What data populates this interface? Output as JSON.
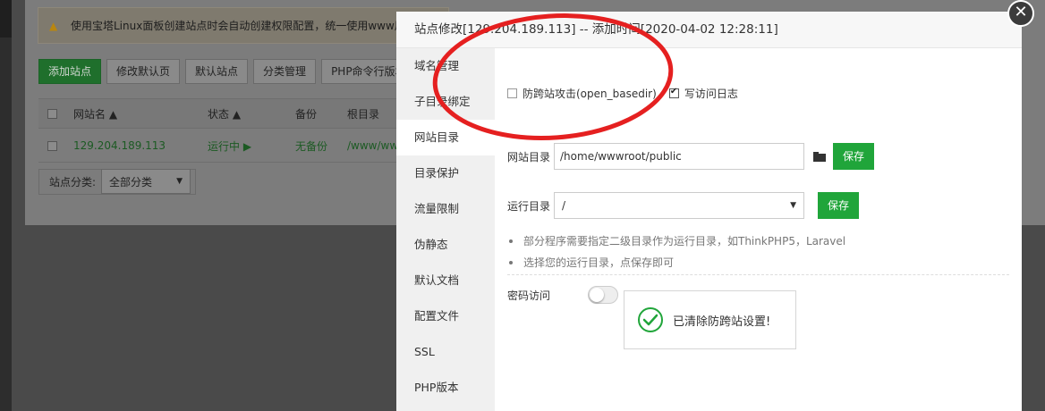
{
  "background": {
    "alert_text": "使用宝塔Linux面板创建站点时会自动创建权限配置，统一使用www用",
    "toolbar": [
      "添加站点",
      "修改默认页",
      "默认站点",
      "分类管理",
      "PHP命令行版本"
    ],
    "table_headers": {
      "name": "网站名 ▲",
      "status": "状态 ▲",
      "backup": "备份",
      "root": "根目录"
    },
    "row": {
      "name": "129.204.189.113",
      "status": "运行中 ▶",
      "backup": "无备份",
      "root": "/www/ww"
    },
    "filter": {
      "label": "站点分类:",
      "value": "全部分类"
    }
  },
  "modal": {
    "title": "站点修改[129.204.189.113] -- 添加时间[2020-04-02 12:28:11]",
    "nav": [
      "域名管理",
      "子目录绑定",
      "网站目录",
      "目录保护",
      "流量限制",
      "伪静态",
      "默认文档",
      "配置文件",
      "SSL",
      "PHP版本"
    ],
    "active_nav": "网站目录",
    "options": {
      "anti_cross": {
        "label": "防跨站攻击(open_basedir)",
        "checked": false
      },
      "access_log": {
        "label": "写访问日志",
        "checked": true
      }
    },
    "site_dir": {
      "label": "网站目录",
      "value": "/home/wwwroot/public",
      "save": "保存"
    },
    "run_dir": {
      "label": "运行目录",
      "value": "/",
      "save": "保存"
    },
    "tips": [
      "部分程序需要指定二级目录作为运行目录，如ThinkPHP5，Laravel",
      "选择您的运行目录，点保存即可"
    ],
    "password_access": {
      "label": "密码访问",
      "enabled": false
    },
    "toast": "已清除防跨站设置!"
  },
  "colors": {
    "accent_green": "#20a53a",
    "annotation_red": "#e52020"
  }
}
